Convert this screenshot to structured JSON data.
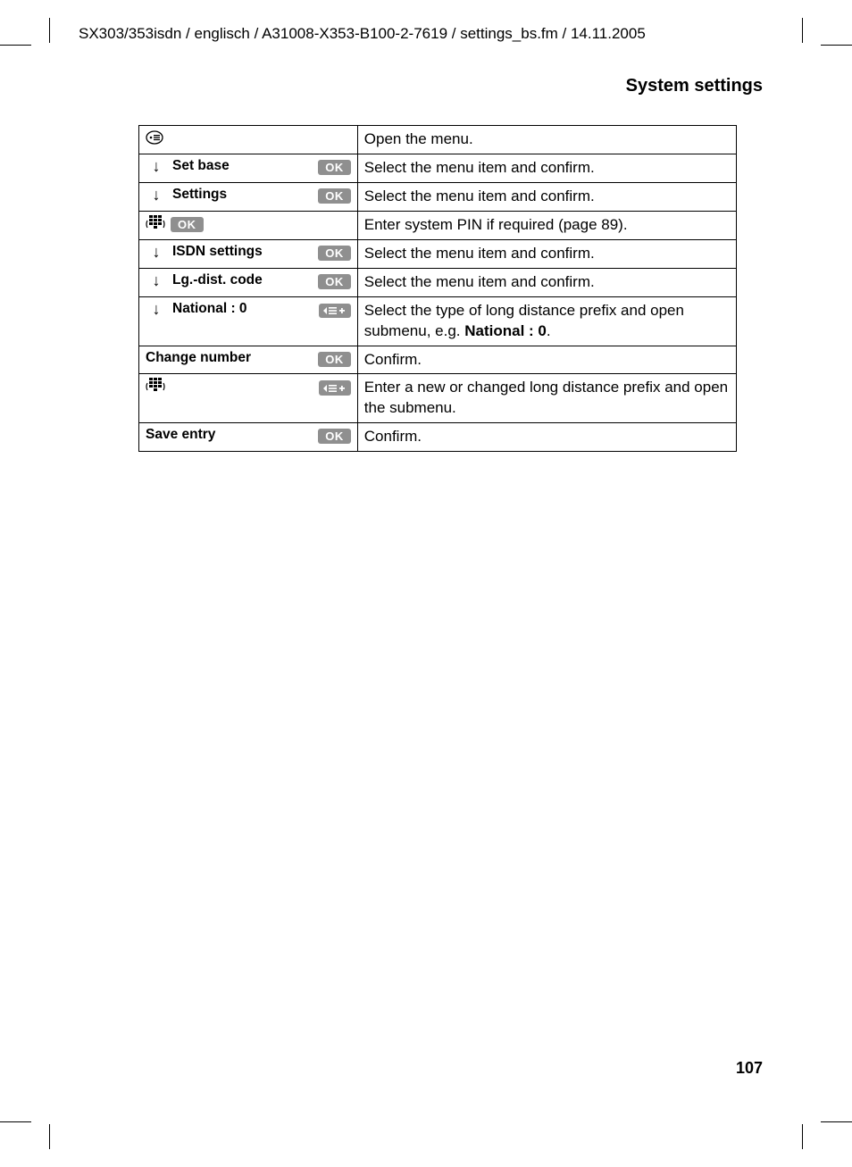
{
  "header_path": "SX303/353isdn / englisch / A31008-X353-B100-2-7619 / settings_bs.fm / 14.11.2005",
  "section_title": "System settings",
  "page_number": "107",
  "btn": {
    "ok": "OK"
  },
  "rows": [
    {
      "icon": "vmenu",
      "label": "",
      "btn": "",
      "desc": "Open the menu."
    },
    {
      "icon": "arrow",
      "label": "Set base",
      "btn": "ok",
      "desc": "Select the menu item and confirm."
    },
    {
      "icon": "arrow",
      "label": "Settings",
      "btn": "ok",
      "desc": "Select the menu item and confirm."
    },
    {
      "icon": "keypad",
      "label": "",
      "btn": "ok",
      "btn_inline": true,
      "desc": "Enter system PIN if required (page 89)."
    },
    {
      "icon": "arrow",
      "label": "ISDN settings",
      "btn": "ok",
      "desc": "Select the menu item and confirm."
    },
    {
      "icon": "arrow",
      "label": "Lg.-dist. code",
      "btn": "ok",
      "desc": "Select the menu item and confirm."
    },
    {
      "icon": "arrow",
      "label": "National : 0",
      "btn": "menu",
      "desc_pre": "Select the type of long distance prefix and open submenu, e.g. ",
      "desc_bold": "National : 0",
      "desc_post": "."
    },
    {
      "icon": "",
      "label": "Change number",
      "label_noindent": true,
      "btn": "ok",
      "desc": "Confirm."
    },
    {
      "icon": "keypad",
      "label": "",
      "btn": "menu",
      "desc": "Enter a new or changed long distance prefix and open the submenu."
    },
    {
      "icon": "",
      "label": "Save entry",
      "label_noindent": true,
      "btn": "ok",
      "desc": "Confirm."
    }
  ]
}
